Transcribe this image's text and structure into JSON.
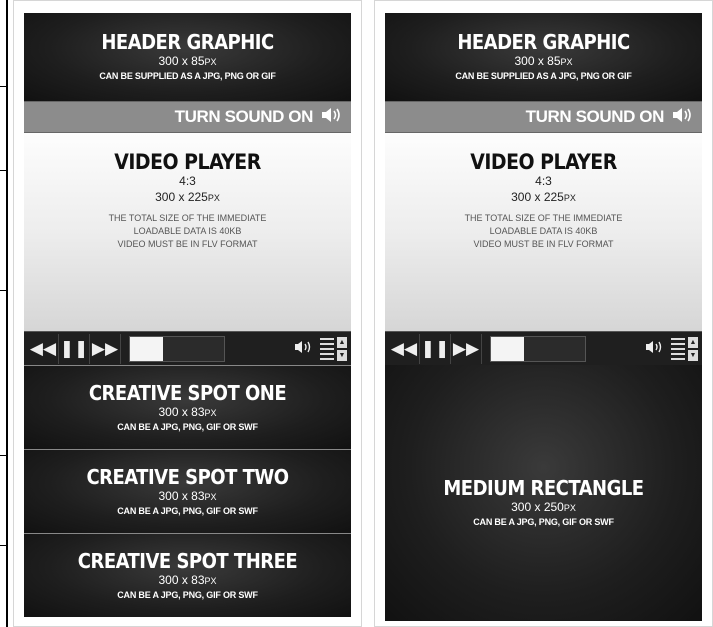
{
  "left_column": {
    "header": {
      "title": "HEADER GRAPHIC",
      "size": "300 x 85",
      "unit": "PX",
      "note": "CAN BE SUPPLIED AS A JPG, PNG OR GIF"
    },
    "sound": {
      "label": "TURN SOUND ON",
      "icon": "speaker-icon"
    },
    "video": {
      "title": "VIDEO PLAYER",
      "ratio": "4:3",
      "size": "300 x 225",
      "unit": "PX",
      "desc_line1": "THE TOTAL SIZE OF THE IMMEDIATE",
      "desc_line2": "LOADABLE DATA IS 40KB",
      "desc_line3": "VIDEO MUST BE IN FLV FORMAT"
    },
    "controls": {
      "rewind": "◀◀",
      "pause": "❚❚",
      "forward": "▶▶",
      "progress": 0.35,
      "volume": "🔊",
      "up": "▲",
      "down": "▼"
    },
    "spots": [
      {
        "title": "CREATIVE SPOT ONE",
        "size": "300 x 83",
        "unit": "PX",
        "note": "CAN BE A JPG, PNG, GIF OR SWF"
      },
      {
        "title": "CREATIVE SPOT TWO",
        "size": "300 x 83",
        "unit": "PX",
        "note": "CAN BE A JPG, PNG, GIF OR SWF"
      },
      {
        "title": "CREATIVE SPOT THREE",
        "size": "300 x 83",
        "unit": "PX",
        "note": "CAN BE A JPG, PNG, GIF OR SWF"
      }
    ]
  },
  "right_column": {
    "header": {
      "title": "HEADER GRAPHIC",
      "size": "300 x 85",
      "unit": "PX",
      "note": "CAN BE SUPPLIED AS A JPG, PNG OR GIF"
    },
    "sound": {
      "label": "TURN SOUND ON",
      "icon": "speaker-icon"
    },
    "video": {
      "title": "VIDEO PLAYER",
      "ratio": "4:3",
      "size": "300 x 225",
      "unit": "PX",
      "desc_line1": "THE TOTAL SIZE OF THE IMMEDIATE",
      "desc_line2": "LOADABLE DATA IS 40KB",
      "desc_line3": "VIDEO MUST BE IN FLV FORMAT"
    },
    "controls": {
      "rewind": "◀◀",
      "pause": "❚❚",
      "forward": "▶▶",
      "progress": 0.35,
      "volume": "🔊",
      "up": "▲",
      "down": "▼"
    },
    "rectangle": {
      "title": "MEDIUM RECTANGLE",
      "size": "300 x 250",
      "unit": "PX",
      "note": "CAN BE A JPG, PNG, GIF OR SWF"
    }
  },
  "colors": {
    "dark": "#1e1e1e",
    "sound_bar": "#8c8c8c",
    "video_bg": "#ededed"
  }
}
